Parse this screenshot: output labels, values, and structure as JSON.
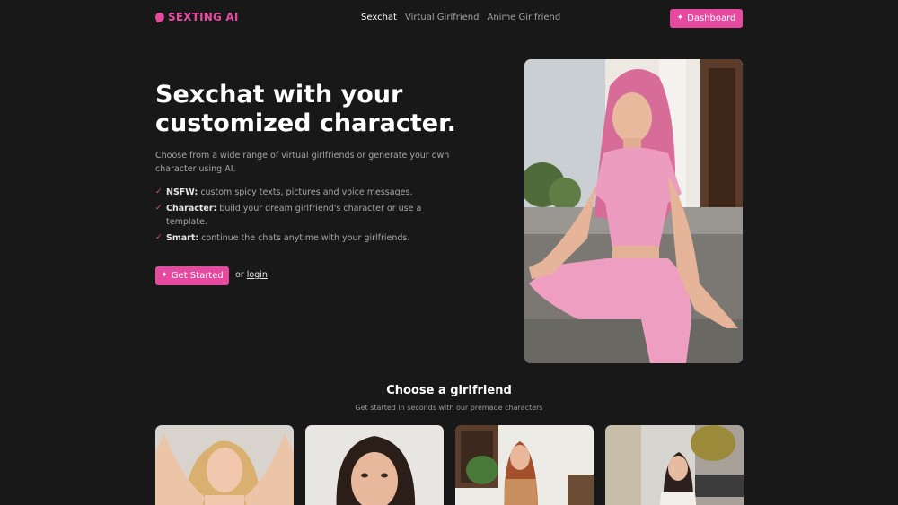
{
  "brand": {
    "name": "SEXTING AI",
    "accent": "#e64aa0"
  },
  "nav": {
    "links": [
      "Sexchat",
      "Virtual Girlfriend",
      "Anime Girlfriend"
    ],
    "active": "Sexchat",
    "dashboard_label": "Dashboard"
  },
  "hero": {
    "title": "Sexchat with your customized character.",
    "subtitle": "Choose from a wide range of virtual girlfriends or generate your own character using AI.",
    "features": [
      {
        "label": "NSFW:",
        "text": "custom spicy texts, pictures and voice messages."
      },
      {
        "label": "Character:",
        "text": "build your dream girlfriend's character or use a template."
      },
      {
        "label": "Smart:",
        "text": "continue the chats anytime with your girlfriends."
      }
    ],
    "cta_label": "Get Started",
    "or_text": "or",
    "login_label": "login"
  },
  "section": {
    "title": "Choose a girlfriend",
    "subtitle": "Get started in seconds with our premade characters"
  },
  "icons": {
    "logo": "chat-bubble-icon",
    "sparkle": "sparkle-icon",
    "check": "check-icon"
  }
}
